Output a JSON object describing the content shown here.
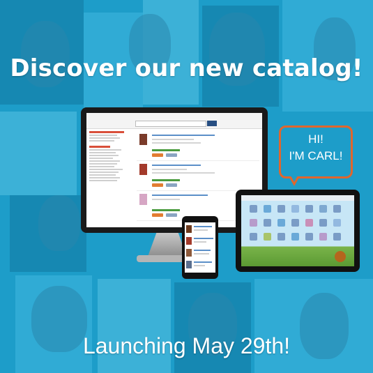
{
  "poster": {
    "headline_top": "Discover our new catalog!",
    "headline_bottom": "Launching May 29th!",
    "speech_line1": "HI!",
    "speech_line2": "I'M CARL!"
  },
  "colors": {
    "background": "#1d9dc9",
    "bubble_border": "#e0662d",
    "text": "#ffffff"
  },
  "icons": [
    "desktop-monitor",
    "smartphone",
    "tablet",
    "speech-bubble"
  ]
}
